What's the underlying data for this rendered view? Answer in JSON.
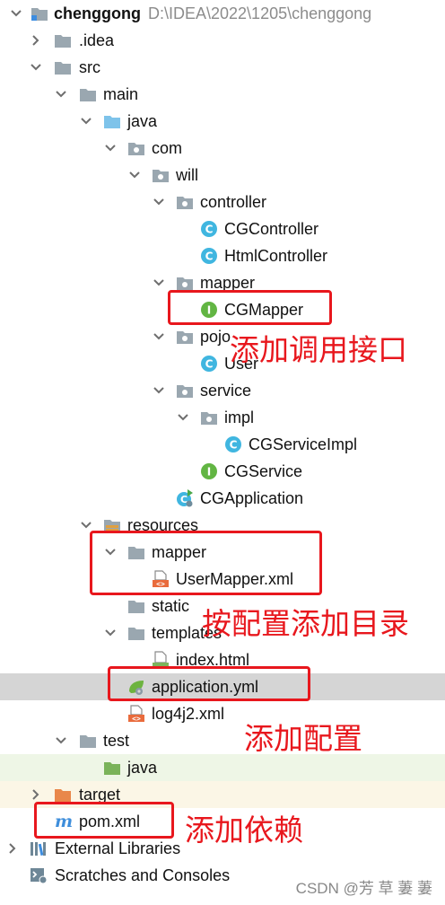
{
  "project": {
    "name": "chenggong",
    "path": "D:\\IDEA\\2022\\1205\\chenggong"
  },
  "tree": {
    "idea": ".idea",
    "src": "src",
    "main": "main",
    "java": "java",
    "com": "com",
    "will": "will",
    "controller": "controller",
    "cg_controller": "CGController",
    "html_controller": "HtmlController",
    "mapper": "mapper",
    "cg_mapper": "CGMapper",
    "pojo": "pojo",
    "user": "User",
    "service": "service",
    "impl": "impl",
    "cg_service_impl": "CGServiceImpl",
    "cg_service": "CGService",
    "cg_application": "CGApplication",
    "resources": "resources",
    "res_mapper": "mapper",
    "user_mapper_xml": "UserMapper.xml",
    "static": "static",
    "templates": "templates",
    "index_html": "index.html",
    "application_yml": "application.yml",
    "log4j2_xml": "log4j2.xml",
    "test": "test",
    "test_java": "java",
    "target": "target",
    "pom_xml": "pom.xml",
    "external_libraries": "External Libraries",
    "scratches": "Scratches and Consoles"
  },
  "annotations": {
    "add_interface": "添加调用接口",
    "add_directory": "按配置添加目录",
    "add_config": "添加配置",
    "add_dependency": "添加依赖"
  },
  "watermark": "CSDN @芳 草 萋 萋",
  "colors": {
    "annotation_red": "#e8171d",
    "folder_gray": "#9aa7b0",
    "java_blue": "#7ec3ea",
    "class_blue": "#40b6e0",
    "interface_green": "#62b543"
  }
}
